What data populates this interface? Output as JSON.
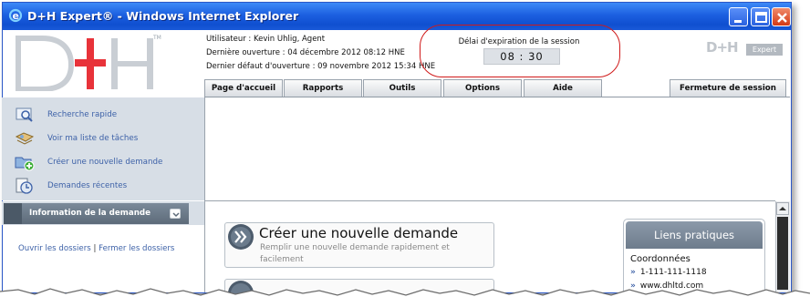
{
  "window": {
    "title": "D+H Expert® - Windows Internet Explorer",
    "colors": {
      "titlebar": "#1c5fe0",
      "close": "#d43a16"
    }
  },
  "header": {
    "logo_text": "D+H",
    "trademark": "TM",
    "user_line": "Utilisateur : Kevin Uhlig, Agent",
    "last_open_line": "Dernière ouverture : 04 décembre 2012 08:12 HNE",
    "last_fail_line": "Dernier défaut d'ouverture : 09 novembre 2012 15:34 HNE",
    "session_label": "Délai d'expiration de la session",
    "session_timer": "08 : 30",
    "brand_small": "D+H",
    "brand_badge": "Expert"
  },
  "nav": {
    "tabs": [
      {
        "label": "Page d'accueil"
      },
      {
        "label": "Rapports"
      },
      {
        "label": "Outils"
      },
      {
        "label": "Options"
      },
      {
        "label": "Aide"
      }
    ],
    "logout": "Fermeture de session"
  },
  "sidebar": {
    "items": [
      {
        "label": "Recherche rapide",
        "icon": "quick-search-icon"
      },
      {
        "label": "Voir ma liste de tâches",
        "icon": "task-list-icon"
      },
      {
        "label": "Créer une nouvelle demande",
        "icon": "new-request-icon"
      },
      {
        "label": "Demandes récentes",
        "icon": "recent-requests-icon"
      }
    ],
    "info_header": "Information de la demande",
    "open_folders": "Ouvrir les dossiers",
    "separator": "|",
    "close_folders": "Fermer les dossiers"
  },
  "main": {
    "card_title": "Créer une nouvelle demande",
    "card_subtitle": "Remplir une nouvelle demande rapidement et facilement",
    "links_title": "Liens pratiques",
    "contacts_heading": "Coordonnées",
    "phone": "1-111-111-1118",
    "website": "www.dhltd.com",
    "bullet": "»"
  },
  "colors": {
    "accent_red": "#e8333a",
    "sidebar_bg": "#d7dee6",
    "link": "#3e62a8",
    "session_border": "#d01a1a"
  }
}
